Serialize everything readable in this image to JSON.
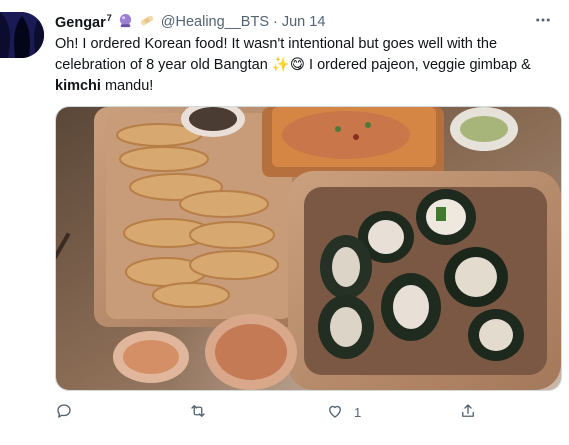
{
  "tweet": {
    "author_name": "Gengar",
    "author_sup": "7",
    "handle": "@Healing__BTS",
    "dot": "·",
    "date": "Jun 14",
    "text_part1": "Oh! I ordered Korean food! It wasn't intentional but goes well with the celebration of 8 year old Bangtan ",
    "text_part2": " I ordered pajeon, veggie gimbap & ",
    "text_bold": "kimchi",
    "text_part3": " mandu!",
    "sparkles_emoji": "✨",
    "yum_emoji": "😋"
  },
  "actions": {
    "reply_count": "",
    "retweet_count": "",
    "like_count": "1"
  },
  "icons": {
    "more": "more-options-icon",
    "reply": "reply-icon",
    "retweet": "retweet-icon",
    "like": "like-icon",
    "share": "share-icon"
  }
}
